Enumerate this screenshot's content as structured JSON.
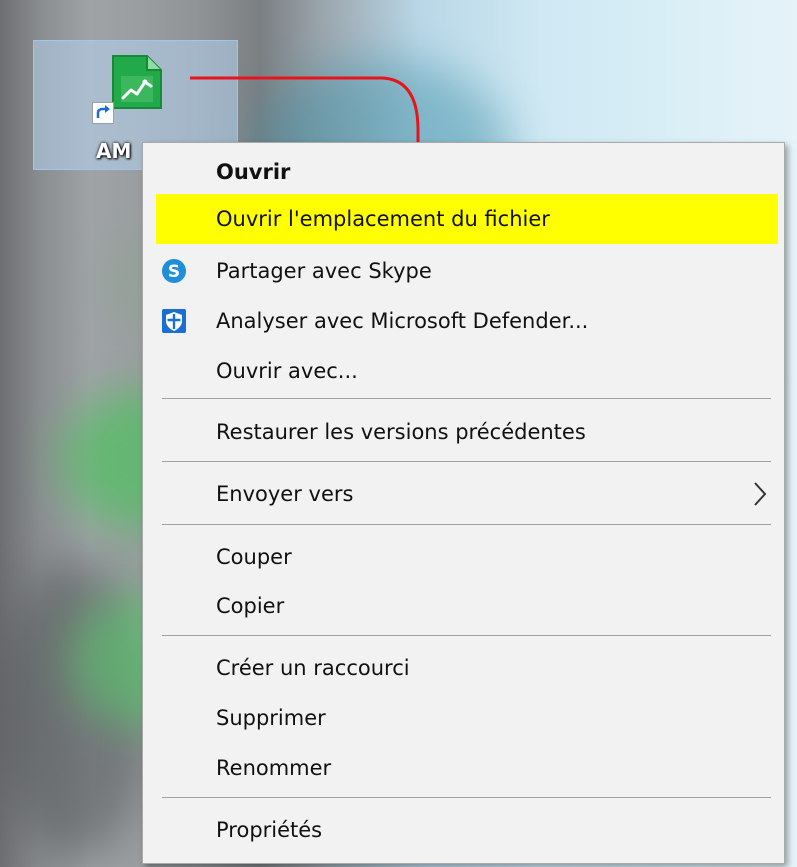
{
  "desktop": {
    "shortcut_label": "AM",
    "file_icon": "spreadsheet-chart-file-icon",
    "shortcut_badge_icon": "shortcut-arrow-icon"
  },
  "annotation": {
    "arrow_color": "#e8141c"
  },
  "context_menu": {
    "highlight_color": "#ffff00",
    "items": [
      {
        "label": "Ouvrir",
        "bold": true
      },
      {
        "label": "Ouvrir l'emplacement du fichier",
        "highlighted": true
      },
      {
        "label": "Partager avec Skype",
        "icon": "skype-icon"
      },
      {
        "label": "Analyser avec Microsoft Defender...",
        "icon": "microsoft-defender-shield-icon"
      },
      {
        "label": "Ouvrir avec..."
      },
      {
        "label": "Restaurer les versions précédentes"
      },
      {
        "label": "Envoyer vers",
        "submenu": true
      },
      {
        "label": "Couper"
      },
      {
        "label": "Copier"
      },
      {
        "label": "Créer un raccourci"
      },
      {
        "label": "Supprimer"
      },
      {
        "label": "Renommer"
      },
      {
        "label": "Propriétés"
      }
    ]
  }
}
